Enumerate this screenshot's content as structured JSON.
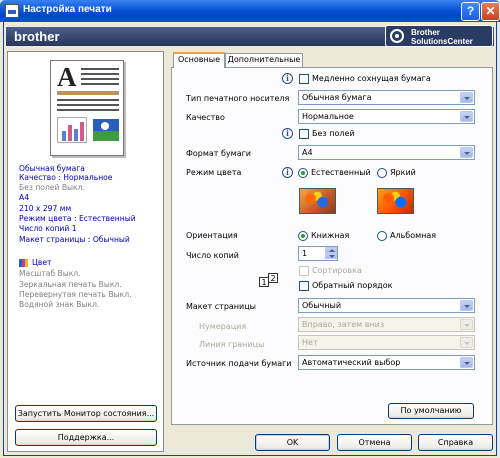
{
  "window": {
    "title": "Настройка печати",
    "help_glyph": "?",
    "close_glyph": "✕"
  },
  "banner": {
    "brand": "brother",
    "solutions_line1": "Brother",
    "solutions_line2": "SolutionsCenter"
  },
  "tabs": [
    {
      "label": "Основные"
    },
    {
      "label": "Дополнительные"
    }
  ],
  "summary": {
    "lines_blue_top": [
      "Обычная бумага",
      "Качество : Нормальное"
    ],
    "line_gray_1": "Без полей Выкл.",
    "lines_blue_mid": [
      "A4",
      "210 x 297 мм",
      "Режим цвета : Естественный",
      "Число копий 1",
      "Макет страницы : Обычный"
    ],
    "color_label": "Цвет",
    "lines_gray_bottom": [
      "Масштаб Выкл.",
      "Зеркальная печать Выкл.",
      "Перевернутая печать Выкл.",
      "Водяной знак Выкл."
    ]
  },
  "left_buttons": {
    "monitor": "Запустить Монитор состояния...",
    "support": "Поддержка..."
  },
  "form": {
    "slow_drying_label": "Медленно сохнущая бумага",
    "media_type_label": "Тип печатного носителя",
    "media_type_value": "Обычная бумага",
    "quality_label": "Качество",
    "quality_value": "Нормальное",
    "borderless_label": "Без полей",
    "paper_size_label": "Формат бумаги",
    "paper_size_value": "A4",
    "color_mode_label": "Режим цвета",
    "color_natural": "Естественный",
    "color_vivid": "Яркий",
    "orientation_label": "Ориентация",
    "portrait": "Книжная",
    "landscape": "Альбомная",
    "copies_label": "Число копий",
    "copies_value": "1",
    "collate_label": "Сортировка",
    "reverse_label": "Обратный порядок",
    "order_icon_1": "1",
    "order_icon_2": "2",
    "layout_label": "Макет страницы",
    "layout_value": "Обычный",
    "page_order_label": "Нумерация",
    "page_order_value": "Вправо, затем вниз",
    "border_line_label": "Линия границы",
    "border_line_value": "Нет",
    "paper_source_label": "Источник подачи бумаги",
    "paper_source_value": "Автоматический выбор",
    "default_button": "По умолчанию",
    "info_glyph": "i"
  },
  "footer": {
    "ok": "OK",
    "cancel": "Отмена",
    "help": "Справка"
  },
  "colors": {
    "title_bar": "#0a56d8",
    "banner": "#27375c",
    "summary_blue": "#0000c0",
    "summary_gray": "#808080",
    "tab_highlight": "#f3a43b"
  }
}
